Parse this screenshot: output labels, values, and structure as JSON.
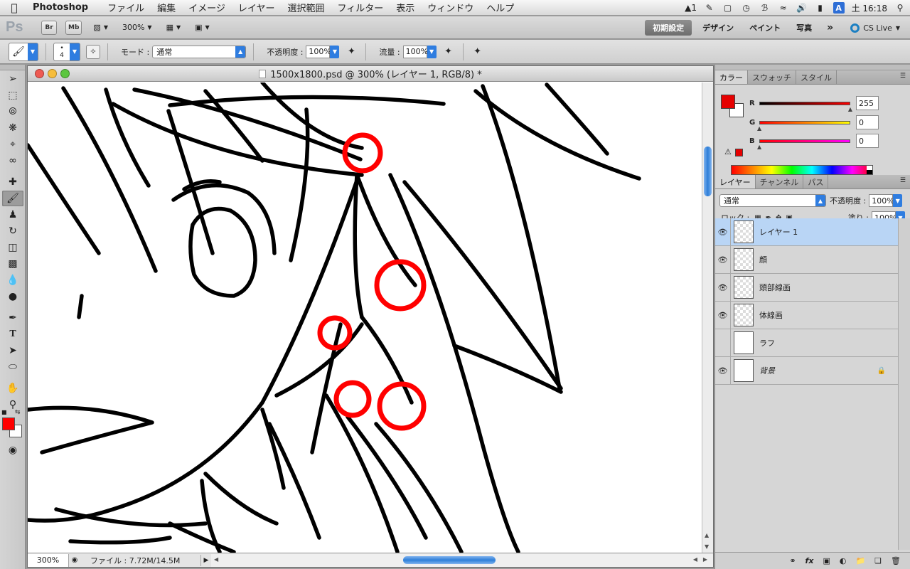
{
  "menubar": {
    "apple_icon": "apple-logo-icon",
    "app_name": "Photoshop",
    "items": [
      "ファイル",
      "編集",
      "イメージ",
      "レイヤー",
      "選択範囲",
      "フィルター",
      "表示",
      "ウィンドウ",
      "ヘルプ"
    ],
    "status": {
      "adobe_badge": "1",
      "input_mode": "A",
      "clock": "土 16:18"
    }
  },
  "appbar": {
    "logo": "Ps",
    "bridge": "Br",
    "mini_bridge": "Mb",
    "zoom": "300%",
    "workspaces": [
      "初期設定",
      "デザイン",
      "ペイント",
      "写真"
    ],
    "active_workspace": "初期設定",
    "more": "»",
    "cs_live": "CS Live"
  },
  "options": {
    "brush_size": "4",
    "mode_label": "モード :",
    "mode_value": "通常",
    "opacity_label": "不透明度 :",
    "opacity_value": "100%",
    "flow_label": "流量 :",
    "flow_value": "100%"
  },
  "document": {
    "title": "1500x1800.psd @ 300% (レイヤー 1, RGB/8) *",
    "zoom": "300%",
    "file_info": "ファイル : 7.72M/14.5M",
    "circle_color": "#ff0000",
    "line_color": "#000000"
  },
  "color_panel": {
    "tabs": [
      "カラー",
      "スウォッチ",
      "スタイル"
    ],
    "channels": [
      {
        "label": "R",
        "value": "255"
      },
      {
        "label": "G",
        "value": "0"
      },
      {
        "label": "B",
        "value": "0"
      }
    ],
    "foreground": "#e60000",
    "background": "#ffffff"
  },
  "layers_panel": {
    "tabs": [
      "レイヤー",
      "チャンネル",
      "パス"
    ],
    "blend_mode": "通常",
    "opacity_label": "不透明度 :",
    "opacity_value": "100%",
    "lock_label": "ロック :",
    "fill_label": "塗り :",
    "fill_value": "100%",
    "layers": [
      {
        "name": "レイヤー 1",
        "visible": true,
        "selected": true
      },
      {
        "name": "顔",
        "visible": true,
        "selected": false
      },
      {
        "name": "頭部線画",
        "visible": true,
        "selected": false
      },
      {
        "name": "体線画",
        "visible": true,
        "selected": false
      },
      {
        "name": "ラフ",
        "visible": false,
        "selected": false
      },
      {
        "name": "背景",
        "visible": true,
        "selected": false,
        "locked": true
      }
    ]
  },
  "toolbar_colors": {
    "foreground": "#ff0000",
    "background": "#ffffff"
  }
}
